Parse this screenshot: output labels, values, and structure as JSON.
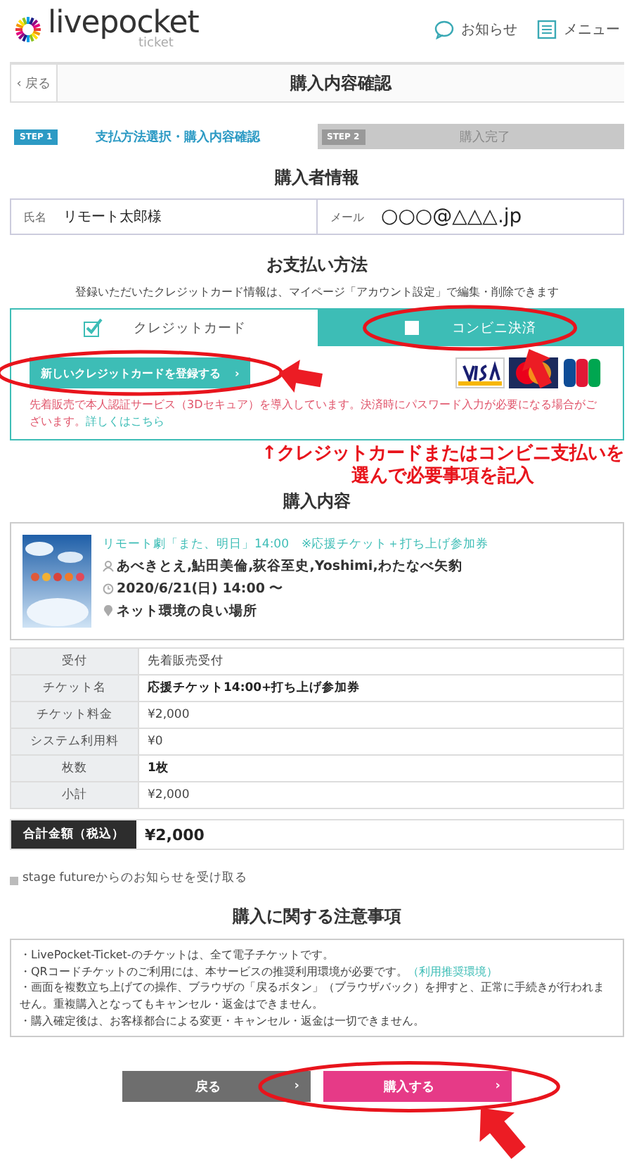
{
  "header": {
    "logo_text": "livepocket",
    "logo_sub": "ticket",
    "links": [
      {
        "kind": "news",
        "label": "お知らせ"
      },
      {
        "kind": "menu",
        "label": "メニュー"
      }
    ]
  },
  "nav": {
    "back_chevron": "‹",
    "back": "戻る",
    "title": "購入内容確認"
  },
  "steps": [
    {
      "badge": "STEP 1",
      "label": "支払方法選択・購入内容確認",
      "selected": true
    },
    {
      "badge": "STEP 2",
      "label": "購入完了",
      "selected": false
    }
  ],
  "buyer": {
    "heading": "購入者情報",
    "fields": [
      {
        "label": "氏名",
        "value": "リモート太郎様"
      },
      {
        "label": "メール",
        "value": "○○○@△△△.jp"
      }
    ]
  },
  "payment": {
    "heading": "お支払い方法",
    "note": "登録いただいたクレジットカード情報は、マイページ「アカウント設定」で編集・削除できます",
    "tabs": [
      {
        "label": "クレジットカード",
        "selected": true
      },
      {
        "label": "コンビニ決済",
        "selected": false
      }
    ],
    "register_button": "新しいクレジットカードを登録する",
    "register_chevron": "›",
    "security_note": "先着販売で本人認証サービス（3Dセキュア）を導入しています。決済時にパスワード入力が必要になる場合がございます。",
    "security_link": "詳しくはこちら"
  },
  "annotation": {
    "lines": [
      "↑クレジットカードまたはコンビニ支払いを",
      "選んで必要事項を記入"
    ]
  },
  "purchase": {
    "heading": "購入内容",
    "event": {
      "title": "リモート劇「また、明日」14:00　※応援チケット＋打ち上げ参加券",
      "performers": "あべきとえ,鮎田美倫,荻谷至史,Yoshimi,わたなべ矢豹",
      "date": "2020/6/21(日) 14:00 〜",
      "venue": "ネット環境の良い場所"
    },
    "rows": [
      {
        "label": "受付",
        "value": "先着販売受付",
        "emphasis": false
      },
      {
        "label": "チケット名",
        "value": "応援チケット14:00+打ち上げ参加券",
        "emphasis": true
      },
      {
        "label": "チケット料金",
        "value": "¥2,000",
        "emphasis": false
      },
      {
        "label": "システム利用料",
        "value": "¥0",
        "emphasis": false
      },
      {
        "label": "枚数",
        "value": "1枚",
        "emphasis": true
      },
      {
        "label": "小計",
        "value": "¥2,000",
        "emphasis": false
      }
    ],
    "total": {
      "label": "合計金額（税込）",
      "value": "¥2,000"
    }
  },
  "newsletter": {
    "label": "stage futureからのお知らせを受け取る",
    "checked": false
  },
  "notes": {
    "heading": "購入に関する注意事項",
    "items": [
      {
        "text": "・LivePocket-Ticket-のチケットは、全て電子チケットです。"
      },
      {
        "text": "・QRコードチケットのご利用には、本サービスの推奨利用環境が必要です。",
        "link": "（利用推奨環境）"
      },
      {
        "text": "・画面を複数立ち上げての操作、ブラウザの「戻るボタン」（ブラウザバック）を押すと、正常に手続きが行われません。重複購入となってもキャンセル・返金はできません。"
      },
      {
        "text": "・購入確定後は、お客様都合による変更・キャンセル・返金は一切できません。"
      }
    ]
  },
  "actions": [
    {
      "kind": "back",
      "label": "戻る",
      "chevron": "›"
    },
    {
      "kind": "purchase",
      "label": "購入する",
      "chevron": "›"
    }
  ]
}
